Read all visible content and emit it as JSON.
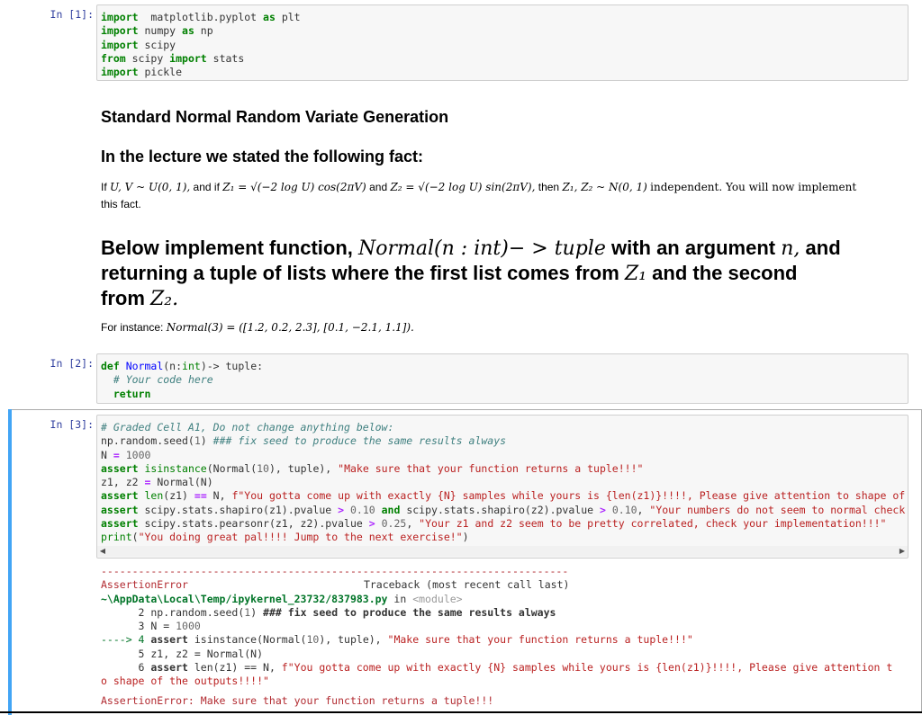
{
  "cells": {
    "c1": {
      "prompt": "In [1]:",
      "lines": [
        [
          [
            "kw",
            "import"
          ],
          [
            "",
            "  matplotlib.pyplot "
          ],
          [
            "kw",
            "as"
          ],
          [
            "",
            " plt"
          ]
        ],
        [
          [
            "kw",
            "import"
          ],
          [
            "",
            " numpy "
          ],
          [
            "kw",
            "as"
          ],
          [
            "",
            " np"
          ]
        ],
        [
          [
            "kw",
            "import"
          ],
          [
            "",
            " scipy"
          ]
        ],
        [
          [
            "kw",
            "from"
          ],
          [
            "",
            " scipy "
          ],
          [
            "kw",
            "import"
          ],
          [
            "",
            " stats"
          ]
        ],
        [
          [
            "kw",
            "import"
          ],
          [
            "",
            " pickle"
          ]
        ]
      ]
    },
    "c2": {
      "prompt": "In [2]:",
      "lines": [
        [
          [
            "kw",
            "def"
          ],
          [
            "",
            ""
          ],
          [
            "fn",
            " Normal"
          ],
          [
            "",
            "(n:"
          ],
          [
            "kw2",
            "int"
          ],
          [
            "",
            ")-> tuple:"
          ]
        ],
        [
          [
            "",
            "  "
          ],
          [
            "cm",
            "# Your code here"
          ]
        ],
        [
          [
            "",
            "  "
          ],
          [
            "kw",
            "return"
          ]
        ]
      ]
    },
    "c3": {
      "prompt": "In [3]:",
      "lines": [
        [
          [
            "cm",
            "# Graded Cell A1, Do not change anything below:"
          ]
        ],
        [
          [
            "",
            "np.random.seed("
          ],
          [
            "nu",
            "1"
          ],
          [
            "",
            ") "
          ],
          [
            "cm",
            "### fix seed to produce the same results always"
          ]
        ],
        [
          [
            "",
            "N "
          ],
          [
            "op",
            "="
          ],
          [
            "",
            " "
          ],
          [
            "nu",
            "1000"
          ]
        ],
        [
          [
            "kw",
            "assert"
          ],
          [
            "",
            " "
          ],
          [
            "kw2",
            "isinstance"
          ],
          [
            "",
            "(Normal("
          ],
          [
            "nu",
            "10"
          ],
          [
            "",
            "), tuple), "
          ],
          [
            "st",
            "\"Make sure that your function returns a tuple!!!\""
          ]
        ],
        [
          [
            "",
            "z1, z2 "
          ],
          [
            "op",
            "="
          ],
          [
            "",
            " Normal(N)"
          ]
        ],
        [
          [
            "kw",
            "assert"
          ],
          [
            "",
            " "
          ],
          [
            "kw2",
            "len"
          ],
          [
            "",
            "(z1) "
          ],
          [
            "op",
            "=="
          ],
          [
            "",
            " N, "
          ],
          [
            "st",
            "f\"You gotta come up with exactly {N} samples while yours is {len(z1)}!!!!, Please give attention to shape of"
          ]
        ],
        [
          [
            "kw",
            "assert"
          ],
          [
            "",
            " scipy.stats.shapiro(z1).pvalue "
          ],
          [
            "op",
            ">"
          ],
          [
            "",
            " "
          ],
          [
            "nu",
            "0.10"
          ],
          [
            "",
            " "
          ],
          [
            "kw",
            "and"
          ],
          [
            "",
            " scipy.stats.shapiro(z2).pvalue "
          ],
          [
            "op",
            ">"
          ],
          [
            "",
            " "
          ],
          [
            "nu",
            "0.10"
          ],
          [
            "",
            ", "
          ],
          [
            "st",
            "\"Your numbers do not seem to normal check"
          ]
        ],
        [
          [
            "kw",
            "assert"
          ],
          [
            "",
            " scipy.stats.pearsonr(z1, z2).pvalue "
          ],
          [
            "op",
            ">"
          ],
          [
            "",
            " "
          ],
          [
            "nu",
            "0.25"
          ],
          [
            "",
            ", "
          ],
          [
            "st",
            "\"Your z1 and z2 seem to be pretty correlated, check your implementation!!!\""
          ]
        ],
        [
          [
            "kw2",
            "print"
          ],
          [
            "",
            "("
          ],
          [
            "st",
            "\"You doing great pal!!!! Jump to the next exercise!\""
          ],
          [
            "",
            ")"
          ]
        ]
      ]
    }
  },
  "markdown": {
    "title": "Standard Normal Random Variate Generation",
    "subtitle": "In the lecture we stated the following fact:",
    "fact_prefix": "If",
    "fact_uv": "U, V ~ U(0, 1),",
    "fact_and_if": "and if",
    "fact_z1": "Z₁ = √(−2 log U) cos(2πV)",
    "fact_and": "and",
    "fact_z2": "Z₂ = √(−2 log U) sin(2πV),",
    "fact_then": "then",
    "fact_z1z2": "Z₁, Z₂ ~ N(0, 1)",
    "fact_tail": "independent.  You will now implement",
    "fact_line2": "this fact.",
    "heading_a": "Below implement function,",
    "heading_sig": "Normal(n : int)− > tuple",
    "heading_b": "with an argument",
    "heading_n": "n,",
    "heading_c": "and",
    "heading_line2a": "returning a tuple of lists where the first list comes from",
    "heading_z1": "Z₁",
    "heading_line2b": "and the second",
    "heading_line3a": "from",
    "heading_z2": "Z₂.",
    "instance_prefix": "For instance:",
    "instance_expr": "Normal(3) = ([1.2, 0.2, 2.3], [0.1, −2.1, 1.1])."
  },
  "output": {
    "dashes": "---------------------------------------------------------------------------",
    "error_name": "AssertionError",
    "traceback_label": "Traceback (most recent call last)",
    "path": "~\\AppData\\Local\\Temp/ipykernel_23732/837983.py",
    "path_in": " in ",
    "module": "<module>",
    "tb_lines": [
      [
        [
          "",
          "      2 np.random.seed("
        ],
        [
          "nu",
          "1"
        ],
        [
          "",
          ") "
        ],
        [
          "err-bold",
          "### fix seed to produce the same results always"
        ]
      ],
      [
        [
          "",
          "      3 N "
        ],
        [
          "",
          "="
        ],
        [
          "",
          " "
        ],
        [
          "nu",
          "1000"
        ]
      ],
      [
        [
          "err-green",
          "----> 4 "
        ],
        [
          "err-bold",
          "assert"
        ],
        [
          "",
          " isinstance(Normal("
        ],
        [
          "nu",
          "10"
        ],
        [
          "",
          "), tuple), "
        ],
        [
          "st",
          "\"Make sure that your function returns a tuple!!!\""
        ]
      ],
      [
        [
          "",
          "      5 z1, z2 = Normal(N)"
        ]
      ],
      [
        [
          "",
          "      6 "
        ],
        [
          "err-bold",
          "assert"
        ],
        [
          "",
          " len(z1) == N, "
        ],
        [
          "st",
          "f\"You gotta come up with exactly {N} samples while yours is {len(z1)}!!!!, Please give attention t"
        ]
      ],
      [
        [
          "st",
          "o shape of the outputs!!!!\""
        ]
      ]
    ],
    "final_error": "AssertionError: Make sure that your function returns a tuple!!!"
  }
}
